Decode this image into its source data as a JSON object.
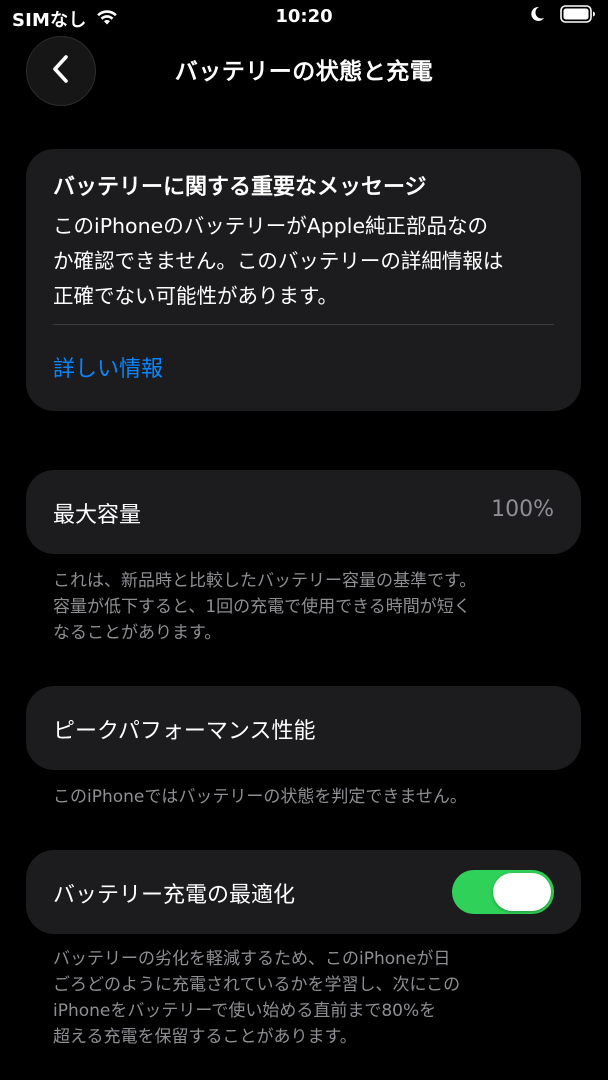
{
  "status_bar": {
    "carrier": "SIMなし",
    "time": "10:20",
    "wifi_icon": "wifi-icon",
    "focus_icon": "moon-icon",
    "battery_icon": "battery-icon"
  },
  "nav": {
    "back_icon": "chevron-left-icon",
    "title": "バッテリーの状態と充電"
  },
  "message_card": {
    "title": "バッテリーに関する重要なメッセージ",
    "body_lines": [
      "このiPhoneのバッテリーがApple純正部品なの",
      "か確認できません。このバッテリーの詳細情報は",
      "正確でない可能性があります。"
    ],
    "link": "詳しい情報"
  },
  "max_capacity": {
    "label": "最大容量",
    "value": "100%",
    "footnote_lines": [
      "これは、新品時と比較したバッテリー容量の基準です。",
      "容量が低下すると、1回の充電で使用できる時間が短く",
      "なることがあります。"
    ]
  },
  "peak_performance": {
    "label": "ピークパフォーマンス性能",
    "footnote": "このiPhoneではバッテリーの状態を判定できません。"
  },
  "optimized_charging": {
    "label": "バッテリー充電の最適化",
    "toggle_on": true,
    "footnote_lines": [
      "バッテリーの劣化を軽減するため、このiPhoneが日",
      "ごろどのように充電されているかを学習し、次にこの",
      "iPhoneをバッテリーで使い始める直前まで80%を",
      "超える充電を保留することがあります。"
    ]
  },
  "colors": {
    "background": "#000000",
    "card": "#1c1c1e",
    "accent_link": "#0a84ff",
    "toggle_on": "#30d158",
    "secondary_text": "#8e8e93"
  }
}
